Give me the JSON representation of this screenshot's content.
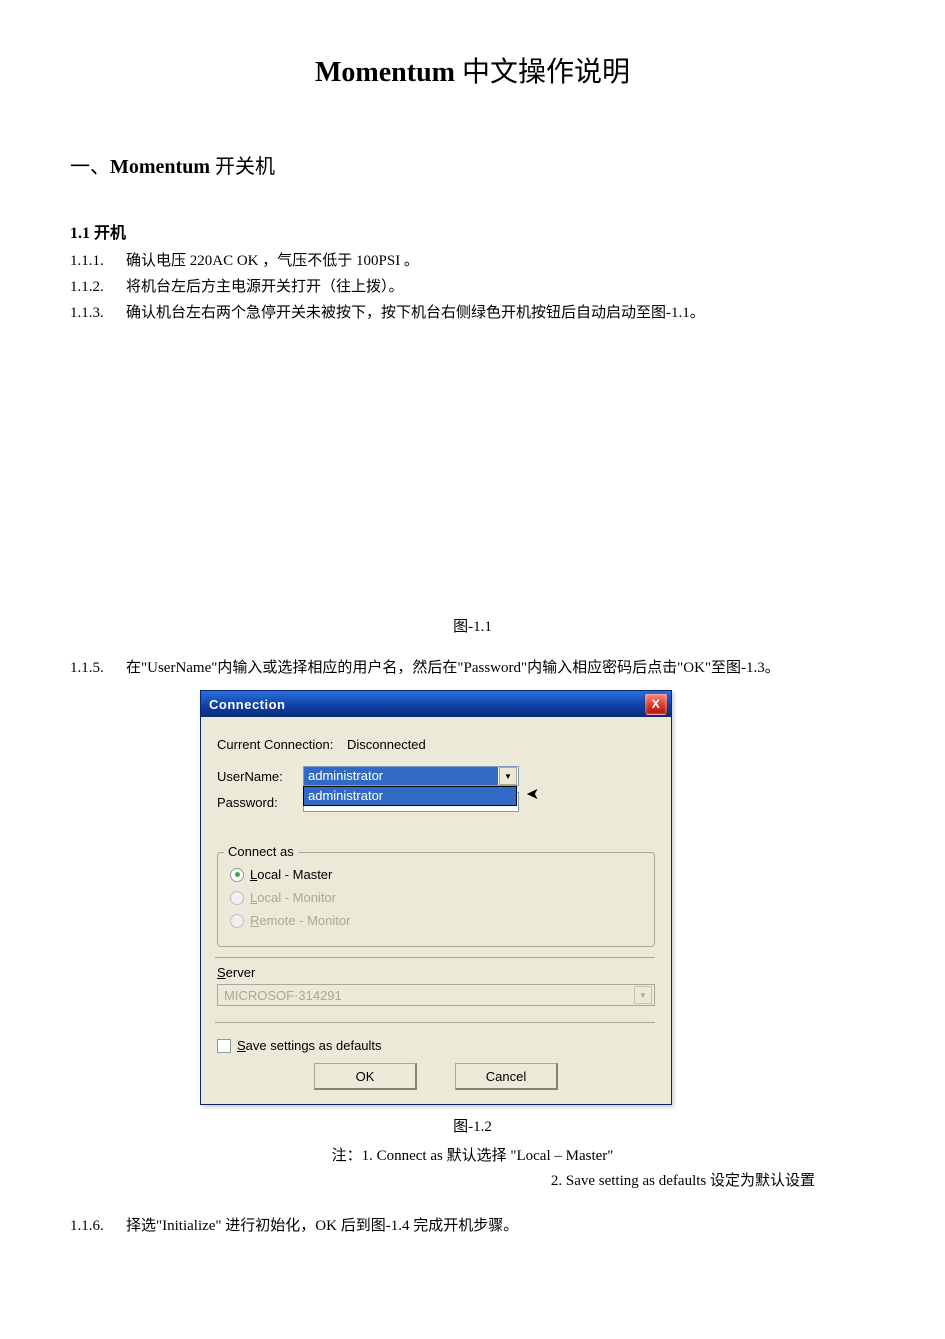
{
  "doc": {
    "title_strong": "Momentum",
    "title_rest": " 中文操作说明",
    "sec1_pre": "一、",
    "sec1_strong": "Momentum",
    "sec1_rest": " 开关机",
    "sub11": "1.1 开机",
    "i111_num": "1.1.1.",
    "i111_txt": "确认电压 220AC OK   ，气压不低于 100PSI        。",
    "i112_num": "1.1.2.",
    "i112_txt": "将机台左后方主电源开关打开（往上拨）。",
    "i113_num": "1.1.3.",
    "i113_txt": "确认机台左右两个急停开关未被按下，按下机台右侧绿色开机按钮后自动启动至图-1.1。",
    "fig11": "图-1.1",
    "i115_num": "1.1.5.",
    "i115_txt": "在\"UserName\"内输入或选择相应的用户名，然后在\"Password\"内输入相应密码后点击\"OK\"至图-1.3。",
    "fig12": "图-1.2",
    "note1": "注：1. Connect as 默认选择 \"Local – Master\"",
    "note2": "2. Save setting as defaults    设定为默认设置",
    "i116_num": "1.1.6.",
    "i116_txt": "择选\"Initialize\"       进行初始化，OK 后到图-1.4 完成开机步骤。"
  },
  "dlg": {
    "title": "Connection",
    "close": "X",
    "cur_conn_lbl": "Current Connection:",
    "cur_conn_val": "Disconnected",
    "user_lbl": "UserName:",
    "user_val": "administrator",
    "user_opt": "administrator",
    "pass_lbl": "Password:",
    "pass_val": "",
    "group_lbl": "Connect as",
    "r1_pre": "L",
    "r1_rest": "ocal - Master",
    "r2_pre": "L",
    "r2_rest": "ocal - Monitor",
    "r3_pre": "R",
    "r3_rest": "emote - Monitor",
    "server_pre": "S",
    "server_rest": "erver",
    "server_val": "MICROSOF·314291",
    "save_pre": "S",
    "save_rest": "ave settings as defaults",
    "ok": "OK",
    "cancel": "Cancel",
    "caret": "▼"
  }
}
